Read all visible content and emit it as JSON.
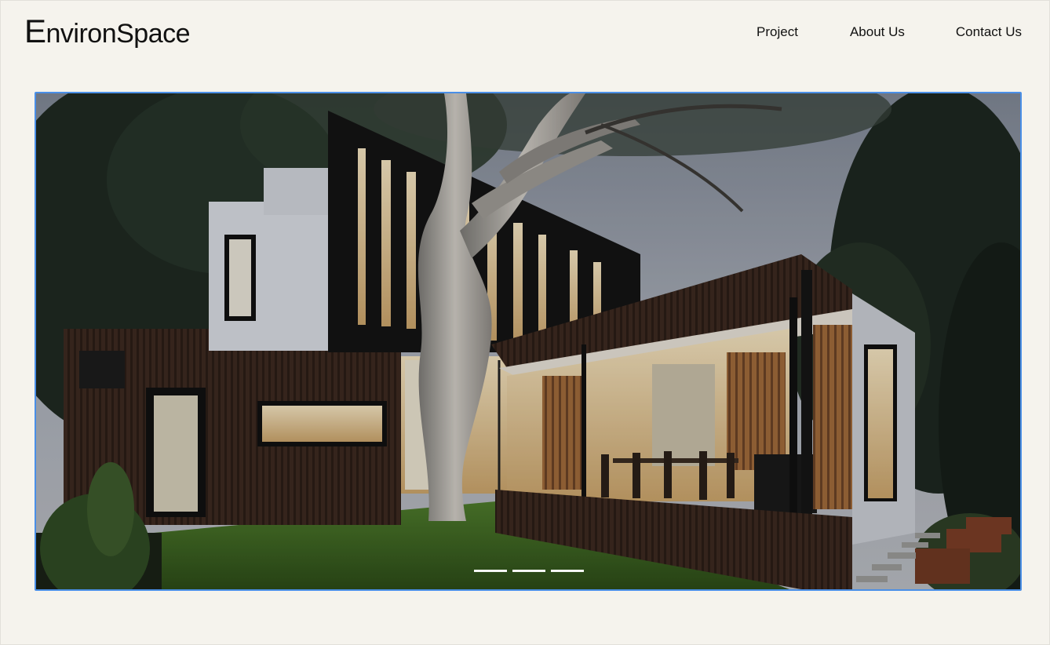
{
  "brand": {
    "logo_first": "E",
    "logo_rest": "nvironSpace"
  },
  "nav": {
    "items": [
      {
        "label": "Project"
      },
      {
        "label": "About Us"
      },
      {
        "label": "Contact Us"
      }
    ]
  },
  "hero": {
    "image_icon": "modern-house-photo",
    "slide_count": 3,
    "active_slide": 1
  },
  "colors": {
    "background": "#f5f3ed",
    "accent_border": "#4a8fe7",
    "text": "#111111"
  }
}
